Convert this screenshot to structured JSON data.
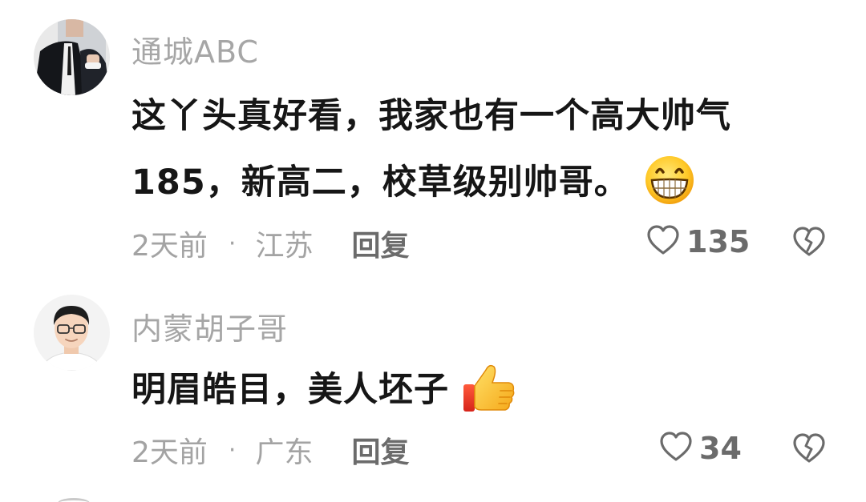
{
  "comments": [
    {
      "username": "通城ABC",
      "text_line1": "这丫头真好看，我家也有一个高大帅气",
      "text_line2": "185，新高二，校草级别帅哥。",
      "emoji": "grinning-face-icon",
      "time": "2天前",
      "separator": "·",
      "location": "江苏",
      "reply_label": "回复",
      "likes": "135"
    },
    {
      "username": "内蒙胡子哥",
      "text_line1": "明眉皓目，美人坯子",
      "emoji": "thumbs-up-icon",
      "time": "2天前",
      "separator": "·",
      "location": "广东",
      "reply_label": "回复",
      "likes": "34"
    }
  ],
  "colors": {
    "username": "#a6a6a6",
    "text": "#161616",
    "meta": "#a3a3a3",
    "action": "#6b6b6b",
    "background": "#ffffff"
  }
}
